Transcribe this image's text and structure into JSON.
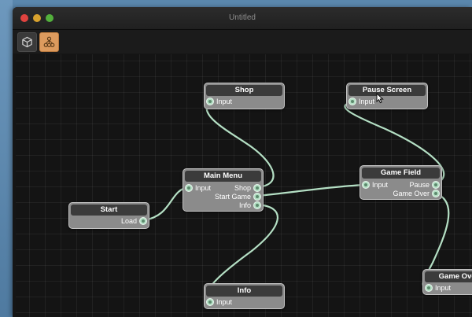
{
  "window": {
    "title": "Untitled"
  },
  "toolbar": {
    "tools": [
      {
        "icon": "cube-icon"
      },
      {
        "icon": "node-graph-icon",
        "active": true
      }
    ]
  },
  "colors": {
    "wire": "#b4dfc4",
    "node_body": "#8b8b8b",
    "node_header": "#3b3b3b",
    "active_tool": "#dd9b5e"
  },
  "nodes": {
    "shop": {
      "title": "Shop",
      "inputs": [
        "Input"
      ],
      "outputs": []
    },
    "pause_screen": {
      "title": "Pause Screen",
      "inputs": [
        "Input"
      ],
      "outputs": []
    },
    "main_menu": {
      "title": "Main Menu",
      "inputs": [
        "Input"
      ],
      "outputs": [
        "Shop",
        "Start Game",
        "Info"
      ]
    },
    "game_field": {
      "title": "Game Field",
      "inputs": [
        "Input"
      ],
      "outputs": [
        "Pause",
        "Game Over"
      ]
    },
    "start": {
      "title": "Start",
      "inputs": [],
      "outputs": [
        "Load"
      ]
    },
    "info": {
      "title": "Info",
      "inputs": [
        "Input"
      ],
      "outputs": []
    },
    "game_over": {
      "title": "Game Over",
      "inputs": [
        "Input"
      ],
      "outputs": []
    }
  },
  "connections": [
    {
      "from": "start.Load",
      "to": "main_menu.Input"
    },
    {
      "from": "main_menu.Shop",
      "to": "shop.Input"
    },
    {
      "from": "main_menu.Start Game",
      "to": "game_field.Input"
    },
    {
      "from": "main_menu.Info",
      "to": "info.Input"
    },
    {
      "from": "game_field.Pause",
      "to": "pause_screen.Input"
    },
    {
      "from": "game_field.Game Over",
      "to": "game_over.Input"
    }
  ]
}
